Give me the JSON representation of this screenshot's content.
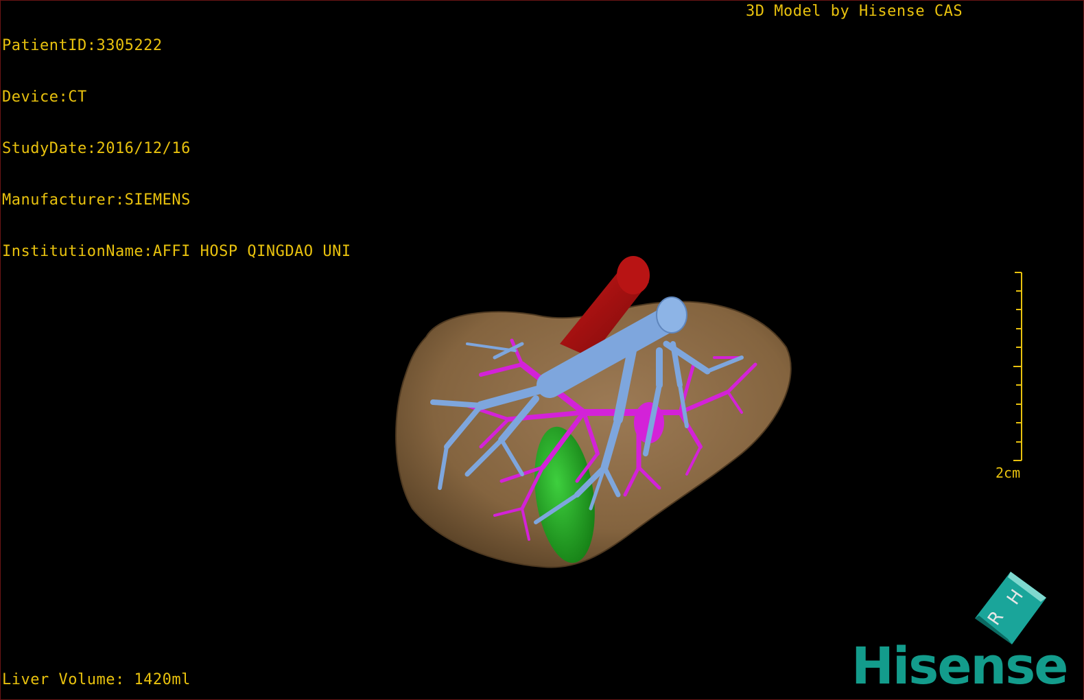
{
  "dicom": {
    "patient_id": "PatientID:3305222",
    "device": "Device:CT",
    "study_date": "StudyDate:2016/12/16",
    "manufacturer": "Manufacturer:SIEMENS",
    "institution": "InstitutionName:AFFI HOSP QINGDAO UNI"
  },
  "credit": "3D Model by Hisense CAS",
  "liver_volume": "Liver Volume: 1420ml",
  "scale": {
    "label": "2cm"
  },
  "orientation": {
    "face_letters": [
      "H",
      "R"
    ]
  },
  "brand": "Hisense",
  "colors": {
    "overlay_text": "#e9c20e",
    "liver": "#8a6a48",
    "portal_vein": "#7ea6dd",
    "hepatic_artery": "#d322d8",
    "aorta": "#a01010",
    "gallbladder": "#1fa51f",
    "brand": "#139c8c"
  }
}
